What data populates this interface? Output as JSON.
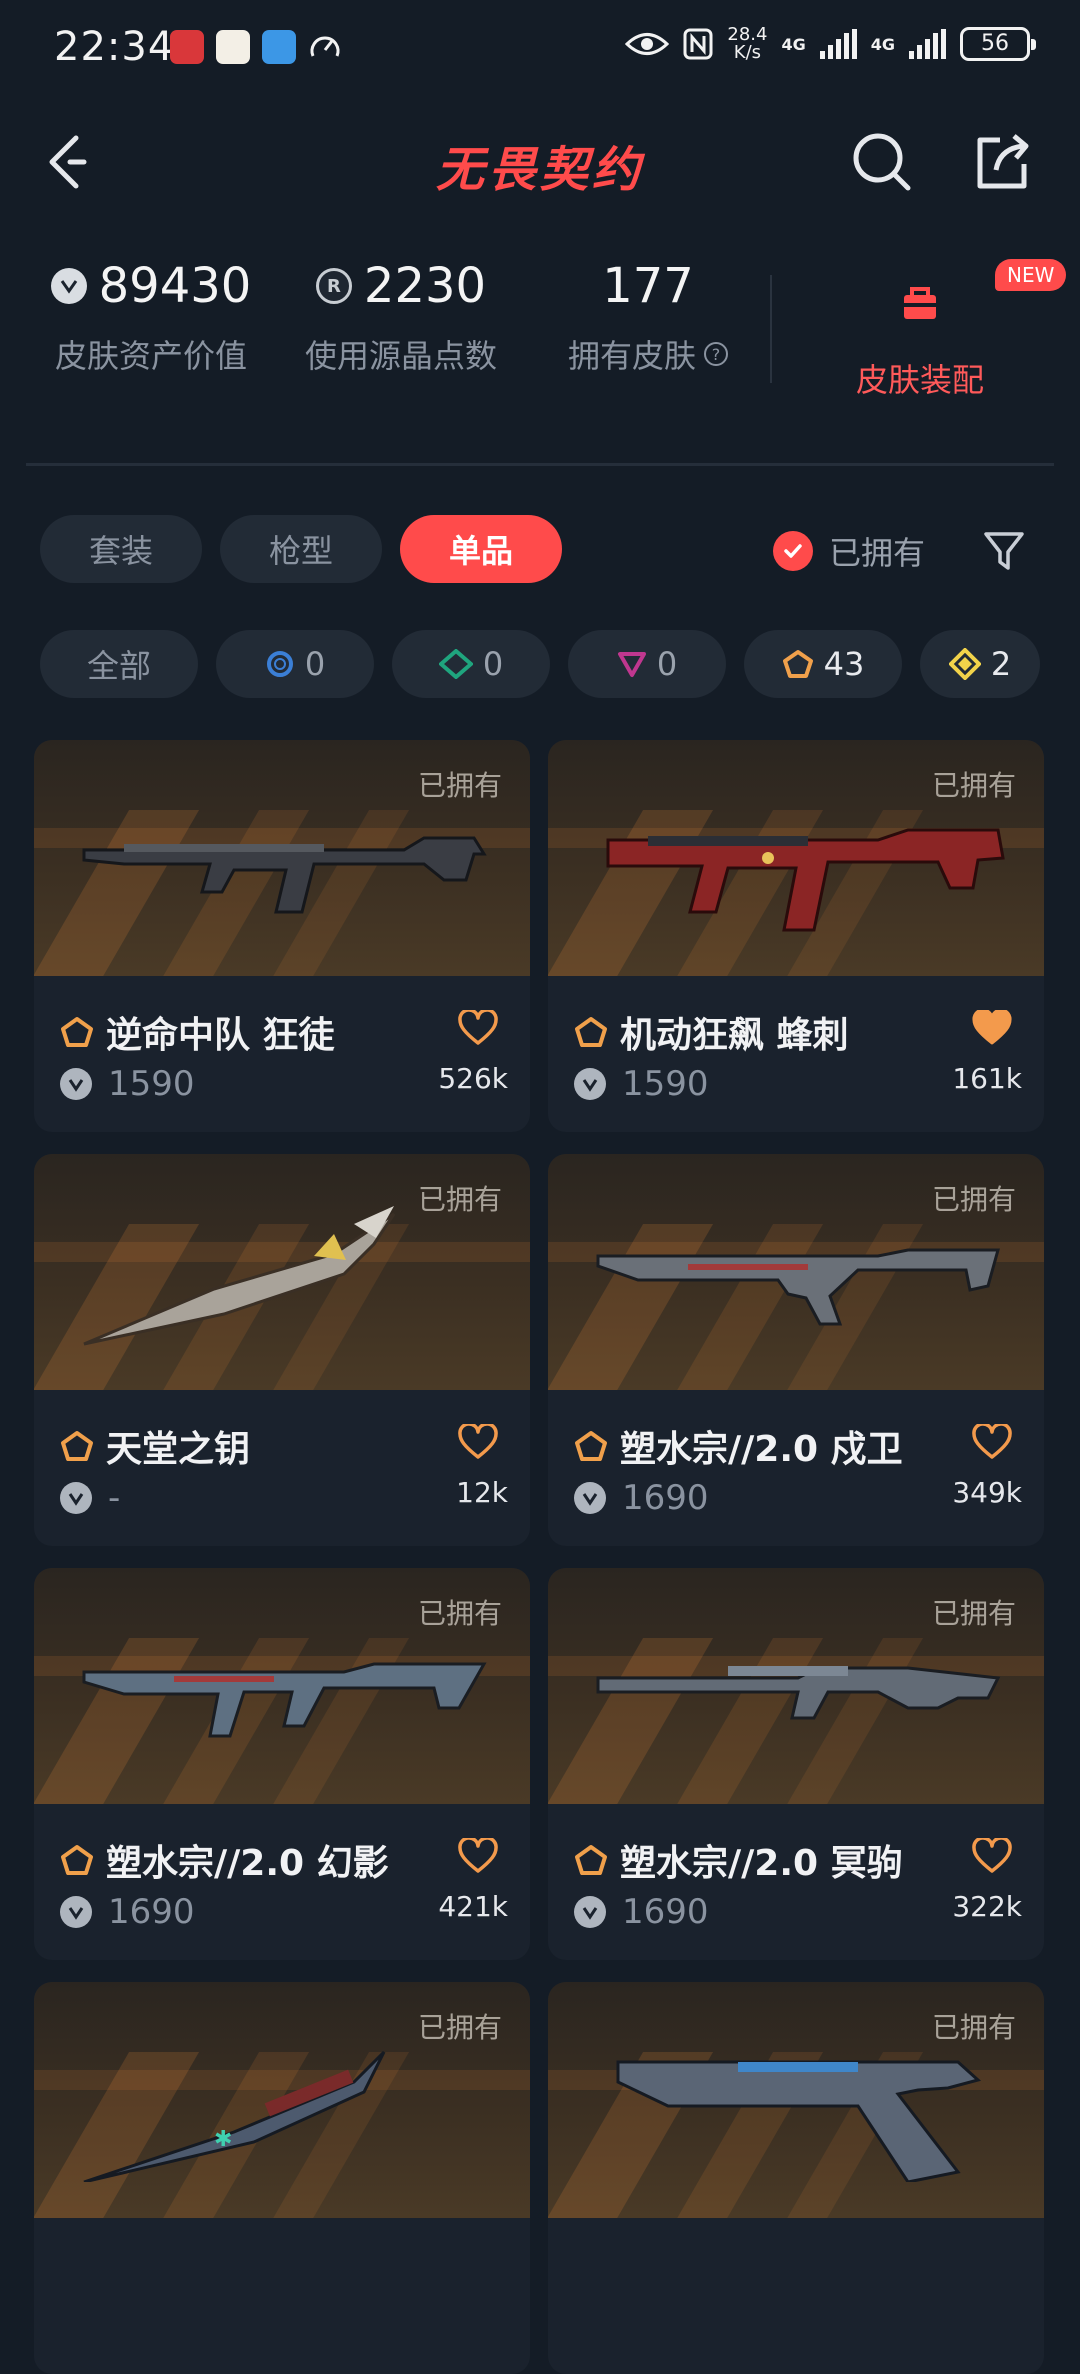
{
  "status": {
    "time": "22:34",
    "speed_value": "28.4",
    "speed_unit": "K/s",
    "net1": "4G",
    "net2": "4G",
    "battery": "56"
  },
  "header": {
    "title": "无畏契约"
  },
  "stats": {
    "asset_value": "89430",
    "asset_label": "皮肤资产价值",
    "points": "2230",
    "points_label": "使用源晶点数",
    "owned": "177",
    "owned_label": "拥有皮肤",
    "equip_label": "皮肤装配",
    "new_badge": "NEW"
  },
  "tabs": [
    "套装",
    "枪型",
    "单品"
  ],
  "owned_filter": "已拥有",
  "chips": [
    {
      "label": "全部"
    },
    {
      "count": "0",
      "color": "#3b7fd6",
      "icon": "ring-rarity-icon"
    },
    {
      "count": "0",
      "color": "#1fa57e",
      "icon": "diamond-rarity-icon"
    },
    {
      "count": "0",
      "color": "#c0378f",
      "icon": "triangle-rarity-icon"
    },
    {
      "count": "43",
      "color": "#f0a04b",
      "icon": "pentagon-rarity-icon"
    },
    {
      "count": "2",
      "color": "#f2d34a",
      "icon": "rhombus-rarity-icon"
    }
  ],
  "cards": [
    {
      "owned": "已拥有",
      "name": "逆命中队 狂徒",
      "price": "1590",
      "likes": "526k",
      "liked": false
    },
    {
      "owned": "已拥有",
      "name": "机动狂飙 蜂刺",
      "price": "1590",
      "likes": "161k",
      "liked": true
    },
    {
      "owned": "已拥有",
      "name": "天堂之钥",
      "price": "-",
      "likes": "12k",
      "liked": false
    },
    {
      "owned": "已拥有",
      "name": "塑水宗//2.0 戍卫",
      "price": "1690",
      "likes": "349k",
      "liked": false
    },
    {
      "owned": "已拥有",
      "name": "塑水宗//2.0 幻影",
      "price": "1690",
      "likes": "421k",
      "liked": false
    },
    {
      "owned": "已拥有",
      "name": "塑水宗//2.0 冥驹",
      "price": "1690",
      "likes": "322k",
      "liked": false
    },
    {
      "owned": "已拥有"
    },
    {
      "owned": "已拥有"
    }
  ],
  "colors": {
    "accent": "#ff4b4b",
    "heart": "#f39a4c",
    "background": "#141c26",
    "tier": "#f0a04b"
  }
}
